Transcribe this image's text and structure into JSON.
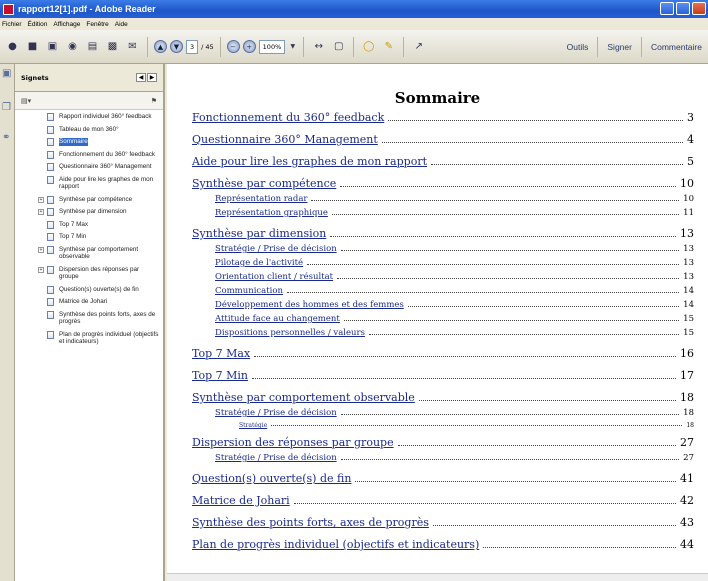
{
  "window": {
    "title": "rapport12[1].pdf - Adobe Reader"
  },
  "menu": [
    "Fichier",
    "Édition",
    "Affichage",
    "Fenêtre",
    "Aide"
  ],
  "toolbar": {
    "page_current": "3",
    "page_total": "/ 45",
    "zoom": "100%",
    "tools_label": "Outils",
    "sign_label": "Signer",
    "comment_label": "Commentaire"
  },
  "panel": {
    "title": "Signets",
    "items": [
      {
        "label": "Rapport individuel 360° feedback",
        "expander": "",
        "selected": false
      },
      {
        "label": "Tableau de mon 360°",
        "expander": "",
        "selected": false
      },
      {
        "label": "Sommaire",
        "expander": "",
        "selected": true
      },
      {
        "label": "Fonctionnement du 360° feedback",
        "expander": "",
        "selected": false
      },
      {
        "label": "Questionnaire 360° Management",
        "expander": "",
        "selected": false
      },
      {
        "label": "Aide pour lire les graphes de mon rapport",
        "expander": "",
        "selected": false
      },
      {
        "label": "Synthèse par compétence",
        "expander": "+",
        "selected": false
      },
      {
        "label": "Synthèse par dimension",
        "expander": "+",
        "selected": false
      },
      {
        "label": "Top 7 Max",
        "expander": "",
        "selected": false
      },
      {
        "label": "Top 7 Min",
        "expander": "",
        "selected": false
      },
      {
        "label": "Synthèse par comportement observable",
        "expander": "+",
        "selected": false
      },
      {
        "label": "Dispersion des réponses par groupe",
        "expander": "+",
        "selected": false
      },
      {
        "label": "Question(s) ouverte(s) de fin",
        "expander": "",
        "selected": false
      },
      {
        "label": "Matrice de Johari",
        "expander": "",
        "selected": false
      },
      {
        "label": "Synthèse des points forts, axes de progrès",
        "expander": "",
        "selected": false
      },
      {
        "label": "Plan de progrès individuel (objectifs et indicateurs)",
        "expander": "",
        "selected": false
      }
    ]
  },
  "document": {
    "title": "Sommaire",
    "toc": [
      {
        "label": "Fonctionnement du 360° feedback",
        "page": "3",
        "level": 1
      },
      {
        "label": "Questionnaire 360° Management",
        "page": "4",
        "level": 1
      },
      {
        "label": "Aide pour lire les graphes de mon rapport",
        "page": "5",
        "level": 1
      },
      {
        "label": "Synthèse par compétence",
        "page": "10",
        "level": 1
      },
      {
        "label": "Représentation radar",
        "page": "10",
        "level": 2
      },
      {
        "label": "Représentation graphique",
        "page": "11",
        "level": 2
      },
      {
        "label": "Synthèse par dimension",
        "page": "13",
        "level": 1
      },
      {
        "label": "Stratégie / Prise de décision",
        "page": "13",
        "level": 2
      },
      {
        "label": "Pilotage de l'activité",
        "page": "13",
        "level": 2
      },
      {
        "label": "Orientation client / résultat",
        "page": "13",
        "level": 2
      },
      {
        "label": "Communication",
        "page": "14",
        "level": 2
      },
      {
        "label": "Développement des hommes et des femmes",
        "page": "14",
        "level": 2
      },
      {
        "label": "Attitude face au changement",
        "page": "15",
        "level": 2
      },
      {
        "label": "Dispositions personnelles / valeurs",
        "page": "15",
        "level": 2
      },
      {
        "label": "Top 7 Max",
        "page": "16",
        "level": 1
      },
      {
        "label": "Top 7 Min",
        "page": "17",
        "level": 1
      },
      {
        "label": "Synthèse par comportement observable",
        "page": "18",
        "level": 1
      },
      {
        "label": "Stratégie / Prise de décision",
        "page": "18",
        "level": 2
      },
      {
        "label": "Stratégie",
        "page": "18",
        "level": 3
      },
      {
        "label": "Dispersion des réponses par groupe",
        "page": "27",
        "level": 1
      },
      {
        "label": "Stratégie / Prise de décision",
        "page": "27",
        "level": 2
      },
      {
        "label": "Question(s) ouverte(s) de fin",
        "page": "41",
        "level": 1
      },
      {
        "label": "Matrice de Johari",
        "page": "42",
        "level": 1
      },
      {
        "label": "Synthèse des points forts, axes de progrès",
        "page": "43",
        "level": 1
      },
      {
        "label": "Plan de progrès individuel (objectifs et indicateurs)",
        "page": "44",
        "level": 1
      }
    ]
  }
}
